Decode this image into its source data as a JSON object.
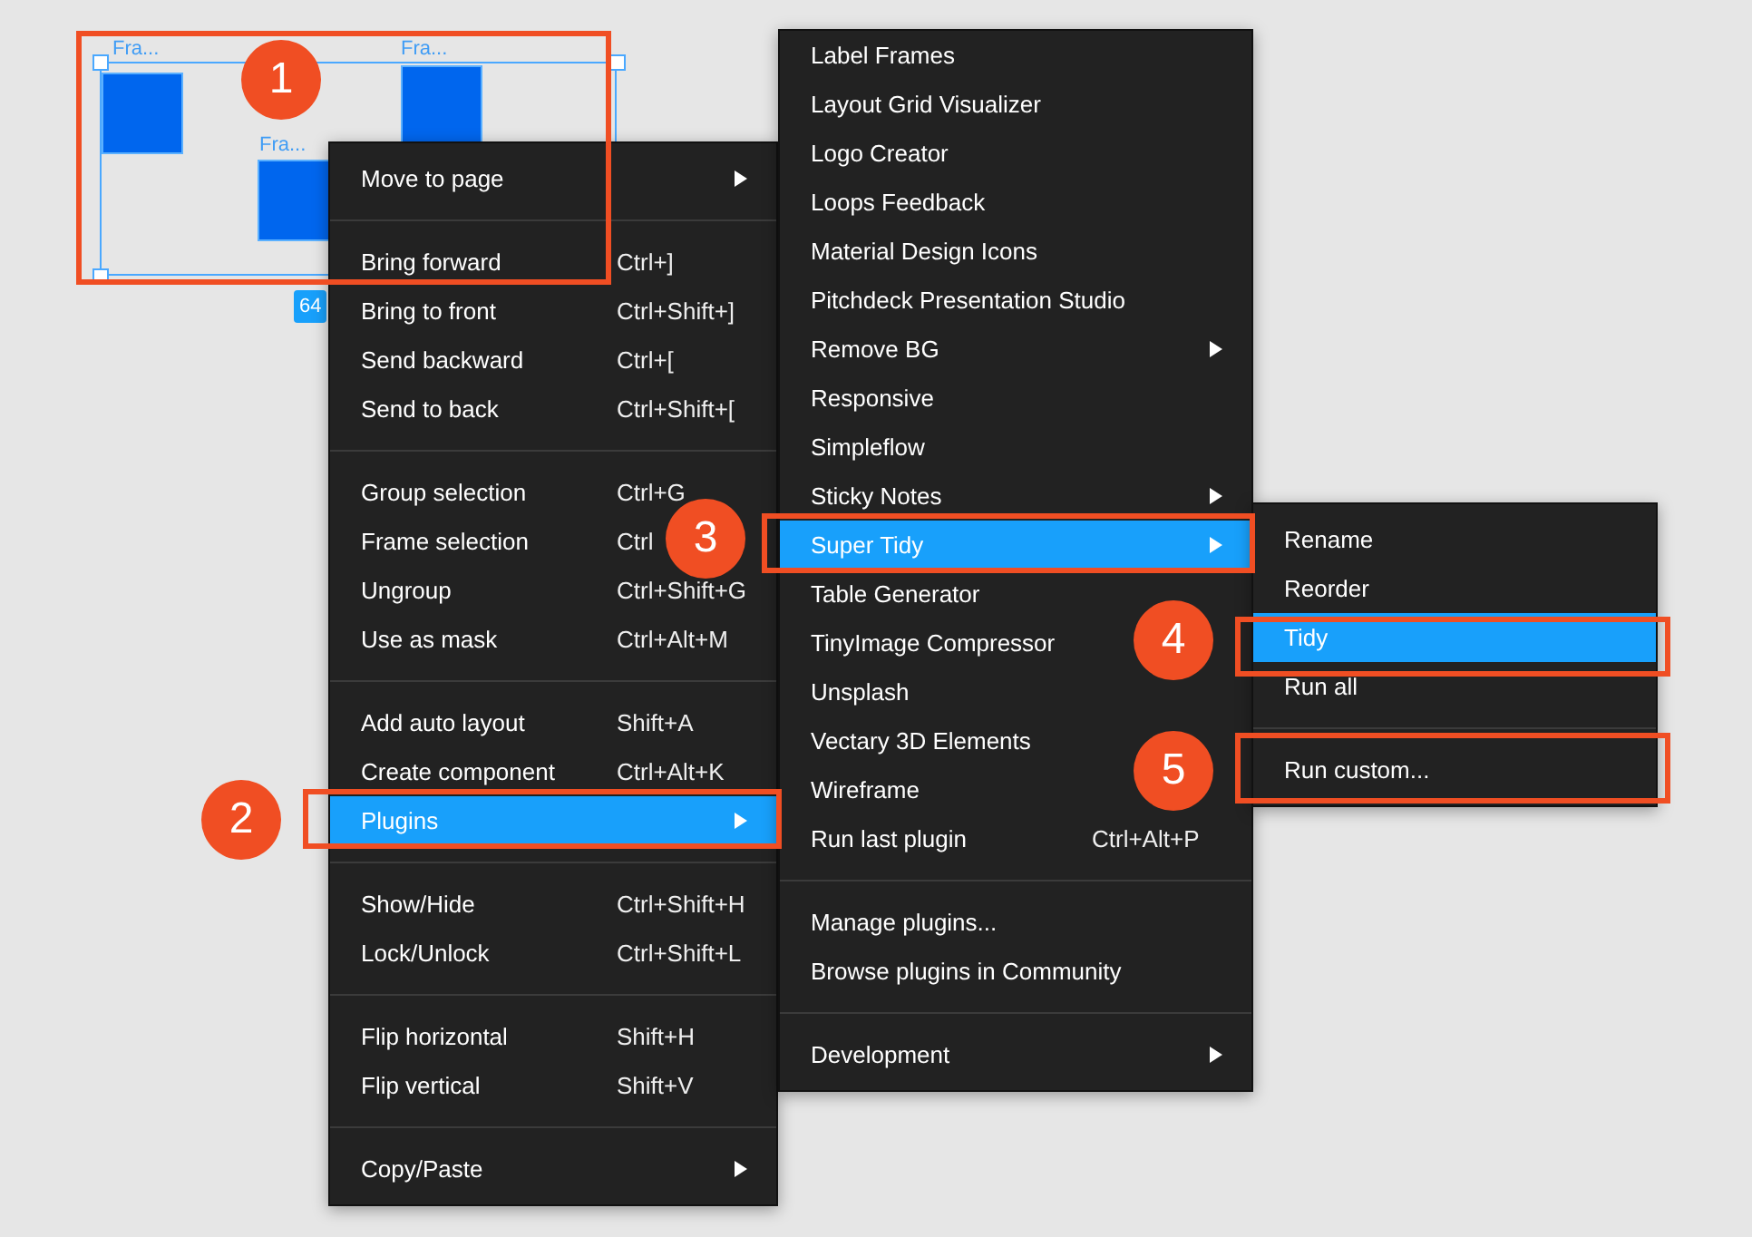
{
  "canvas": {
    "frames": [
      {
        "label": "Fra..."
      },
      {
        "label": "Fra..."
      },
      {
        "label": "Fra..."
      }
    ],
    "size_badge": "64"
  },
  "context_menu": {
    "sections": [
      [
        {
          "label": "Move to page",
          "submenu": true,
          "selected": false
        }
      ],
      [
        {
          "label": "Bring forward",
          "shortcut": "Ctrl+]",
          "submenu": false,
          "selected": false
        },
        {
          "label": "Bring to front",
          "shortcut": "Ctrl+Shift+]",
          "submenu": false,
          "selected": false
        },
        {
          "label": "Send backward",
          "shortcut": "Ctrl+[",
          "submenu": false,
          "selected": false
        },
        {
          "label": "Send to back",
          "shortcut": "Ctrl+Shift+[",
          "submenu": false,
          "selected": false
        }
      ],
      [
        {
          "label": "Group selection",
          "shortcut": "Ctrl+G",
          "submenu": false,
          "selected": false
        },
        {
          "label": "Frame selection",
          "shortcut": "Ctrl",
          "submenu": false,
          "selected": false
        },
        {
          "label": "Ungroup",
          "shortcut": "Ctrl+Shift+G",
          "submenu": false,
          "selected": false
        },
        {
          "label": "Use as mask",
          "shortcut": "Ctrl+Alt+M",
          "submenu": false,
          "selected": false
        }
      ],
      [
        {
          "label": "Add auto layout",
          "shortcut": "Shift+A",
          "submenu": false,
          "selected": false
        },
        {
          "label": "Create component",
          "shortcut": "Ctrl+Alt+K",
          "submenu": false,
          "selected": false
        },
        {
          "label": "Plugins",
          "submenu": true,
          "selected": true
        }
      ],
      [
        {
          "label": "Show/Hide",
          "shortcut": "Ctrl+Shift+H",
          "submenu": false,
          "selected": false
        },
        {
          "label": "Lock/Unlock",
          "shortcut": "Ctrl+Shift+L",
          "submenu": false,
          "selected": false
        }
      ],
      [
        {
          "label": "Flip horizontal",
          "shortcut": "Shift+H",
          "submenu": false,
          "selected": false
        },
        {
          "label": "Flip vertical",
          "shortcut": "Shift+V",
          "submenu": false,
          "selected": false
        }
      ],
      [
        {
          "label": "Copy/Paste",
          "submenu": true,
          "selected": false
        }
      ]
    ]
  },
  "plugins_menu": {
    "sections": [
      [
        {
          "label": "Label Frames",
          "submenu": false,
          "selected": false
        },
        {
          "label": "Layout Grid Visualizer",
          "submenu": false,
          "selected": false
        },
        {
          "label": "Logo Creator",
          "submenu": false,
          "selected": false
        },
        {
          "label": "Loops Feedback",
          "submenu": false,
          "selected": false
        },
        {
          "label": "Material Design Icons",
          "submenu": false,
          "selected": false
        },
        {
          "label": "Pitchdeck Presentation Studio",
          "submenu": false,
          "selected": false
        },
        {
          "label": "Remove BG",
          "submenu": true,
          "selected": false
        },
        {
          "label": "Responsive",
          "submenu": false,
          "selected": false
        },
        {
          "label": "Simpleflow",
          "submenu": false,
          "selected": false
        },
        {
          "label": "Sticky Notes",
          "submenu": true,
          "selected": false
        },
        {
          "label": "Super Tidy",
          "submenu": true,
          "selected": true
        },
        {
          "label": "Table Generator",
          "submenu": false,
          "selected": false
        },
        {
          "label": "TinyImage Compressor",
          "submenu": false,
          "selected": false
        },
        {
          "label": "Unsplash",
          "submenu": false,
          "selected": false
        },
        {
          "label": "Vectary 3D Elements",
          "submenu": false,
          "selected": false
        },
        {
          "label": "Wireframe",
          "submenu": false,
          "selected": false
        },
        {
          "label": "Run last plugin",
          "shortcut": "Ctrl+Alt+P",
          "submenu": false,
          "selected": false
        }
      ],
      [
        {
          "label": "Manage plugins...",
          "submenu": false,
          "selected": false
        },
        {
          "label": "Browse plugins in Community",
          "submenu": false,
          "selected": false
        }
      ],
      [
        {
          "label": "Development",
          "submenu": true,
          "selected": false
        }
      ]
    ]
  },
  "super_tidy_menu": {
    "sections": [
      [
        {
          "label": "Rename",
          "submenu": false,
          "selected": false
        },
        {
          "label": "Reorder",
          "submenu": false,
          "selected": false
        },
        {
          "label": "Tidy",
          "submenu": false,
          "selected": true
        },
        {
          "label": "Run all",
          "submenu": false,
          "selected": false
        }
      ],
      [
        {
          "label": "Run custom...",
          "submenu": false,
          "selected": false
        }
      ]
    ]
  },
  "annotations": [
    {
      "number": "1"
    },
    {
      "number": "2"
    },
    {
      "number": "3"
    },
    {
      "number": "4"
    },
    {
      "number": "5"
    }
  ]
}
